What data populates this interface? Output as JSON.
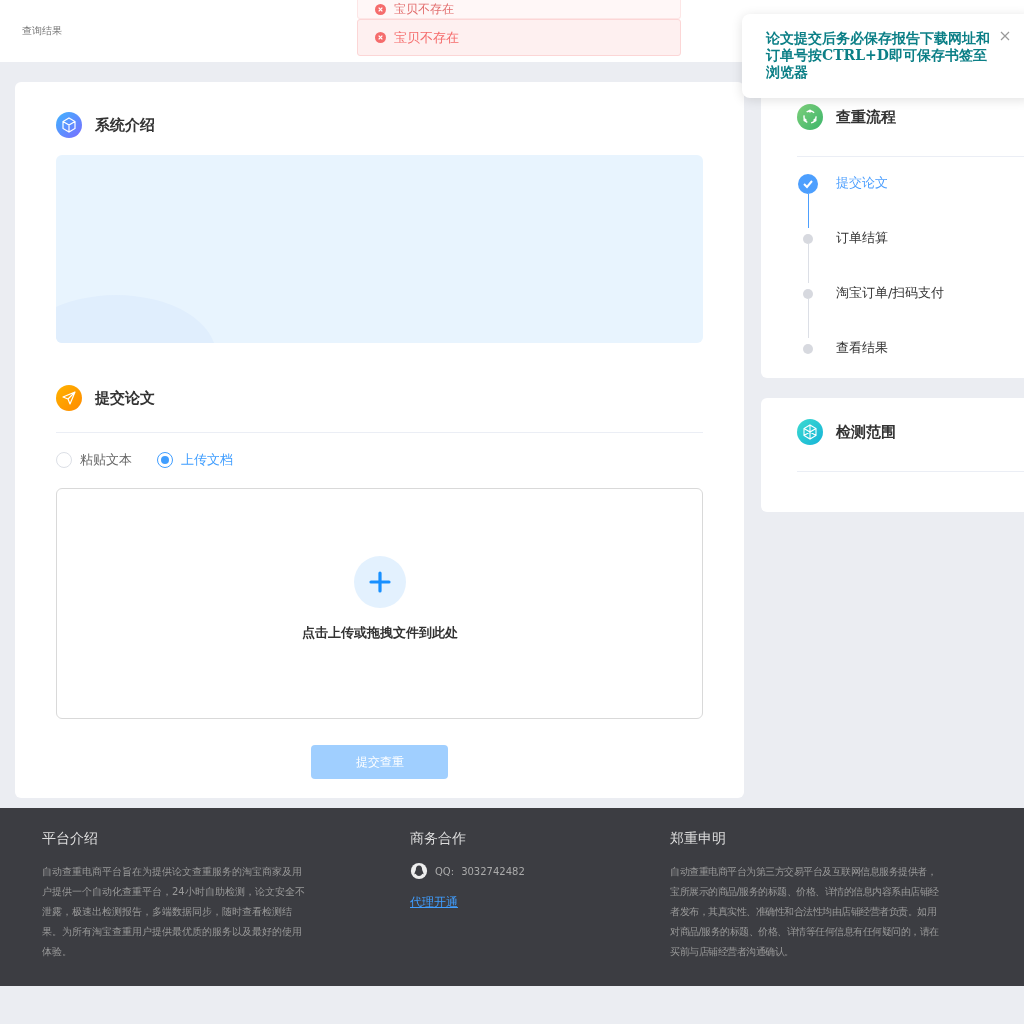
{
  "header": {
    "breadcrumb": "查询结果"
  },
  "toasts": [
    {
      "text": "宝贝不存在",
      "faded": true
    },
    {
      "text": "宝贝不存在",
      "faded": false
    }
  ],
  "notification": {
    "text": "论文提交后务必保存报告下载网址和订单号按CTRL+D即可保存书签至浏览器"
  },
  "intro": {
    "title": "系统介绍"
  },
  "submit": {
    "title": "提交论文",
    "modes": [
      {
        "label": "粘贴文本",
        "selected": false
      },
      {
        "label": "上传文档",
        "selected": true
      }
    ],
    "upload": {
      "label": "点击上传或拖拽文件到此处"
    },
    "button": {
      "label": "提交查重",
      "disabled": true
    }
  },
  "process": {
    "title": "查重流程",
    "steps": [
      {
        "label": "提交论文",
        "finished": true
      },
      {
        "label": "订单结算",
        "finished": false
      },
      {
        "label": "淘宝订单/扫码支付",
        "finished": false
      },
      {
        "label": "查看结果",
        "finished": false
      }
    ]
  },
  "scope": {
    "title": "检测范围"
  },
  "footer": {
    "about": {
      "title": "平台介绍",
      "text": "自动查重电商平台旨在为提供论文查重服务的淘宝商家及用户提供一个自动化查重平台，24小时自助检测，论文安全不泄露，极速出检测报告，多端数据同步，随时查看检测结果。为所有淘宝查重用户提供最优质的服务以及最好的使用体验。"
    },
    "business": {
      "title": "商务合作",
      "qq_label": "QQ:",
      "qq": "3032742482",
      "link": "代理开通"
    },
    "notice": {
      "title": "郑重申明",
      "lines": [
        "自动查重电商平台为第三方交易平台及互联网信息服务提供者，",
        "宝所展示的商品/服务的标题、价格、详情的信息内容系由店铺经",
        "者发布，其真实性、准确性和合法性均由店铺经营者负责。如用",
        "对商品/服务的标题、价格、详情等任何信息有任何疑问的，请在",
        "买前与店铺经营者沟通确认。"
      ]
    }
  }
}
